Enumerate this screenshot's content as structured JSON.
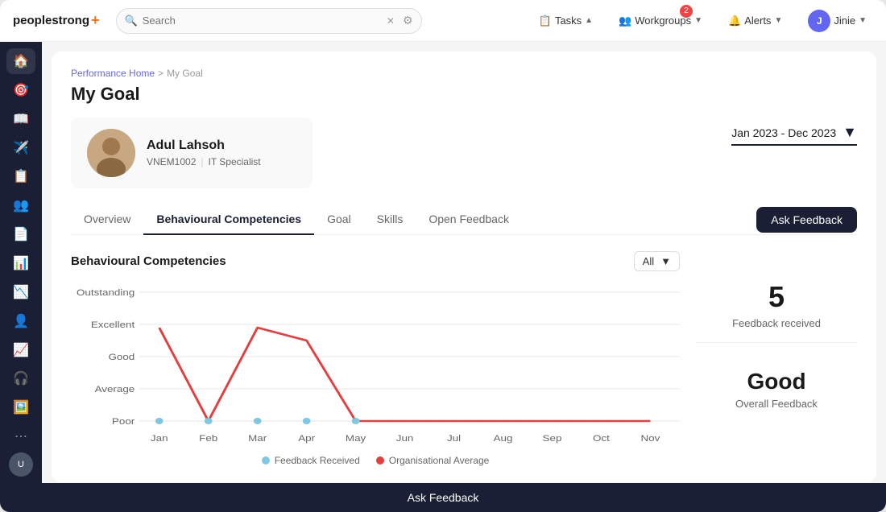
{
  "app": {
    "logo": "peoplestrong",
    "logo_plus": "+"
  },
  "topbar": {
    "search_placeholder": "Search",
    "tasks_label": "Tasks",
    "workgroups_label": "Workgroups",
    "workgroups_badge": "2",
    "alerts_label": "Alerts",
    "user_label": "Jinie",
    "user_initials": "J"
  },
  "sidebar": {
    "icons": [
      "🏠",
      "🎯",
      "📖",
      "✈️",
      "📋",
      "👥",
      "📄",
      "📊",
      "📉",
      "👤",
      "📈",
      "🎧",
      "🖼️",
      "⋯"
    ]
  },
  "breadcrumb": {
    "parent": "Performance Home",
    "separator": ">",
    "current": "My Goal"
  },
  "page": {
    "title": "My Goal"
  },
  "profile": {
    "name": "Adul Lahsoh",
    "id": "VNEM1002",
    "role": "IT Specialist"
  },
  "date_range": {
    "text": "Jan 2023 - Dec 2023"
  },
  "tabs": {
    "items": [
      "Overview",
      "Behavioural Competencies",
      "Goal",
      "Skills",
      "Open Feedback"
    ],
    "active": 1
  },
  "ask_feedback_label": "Ask Feedback",
  "chart": {
    "title": "Behavioural Competencies",
    "filter": "All",
    "y_labels": [
      "Outstanding",
      "Excellent",
      "Good",
      "Average",
      "Poor"
    ],
    "x_labels": [
      "Jan",
      "Feb",
      "Mar",
      "Apr",
      "May",
      "Jun",
      "Jul",
      "Aug",
      "Sep",
      "Oct",
      "Nov"
    ],
    "legend": [
      {
        "label": "Feedback Received",
        "color": "#7ec8e3"
      },
      {
        "label": "Organisational Average",
        "color": "#e53e3e"
      }
    ]
  },
  "stats": {
    "feedback_count": "5",
    "feedback_label": "Feedback received",
    "overall_text": "Good",
    "overall_label": "Overall Feedback"
  },
  "bottom_bar_label": "Ask Feedback"
}
